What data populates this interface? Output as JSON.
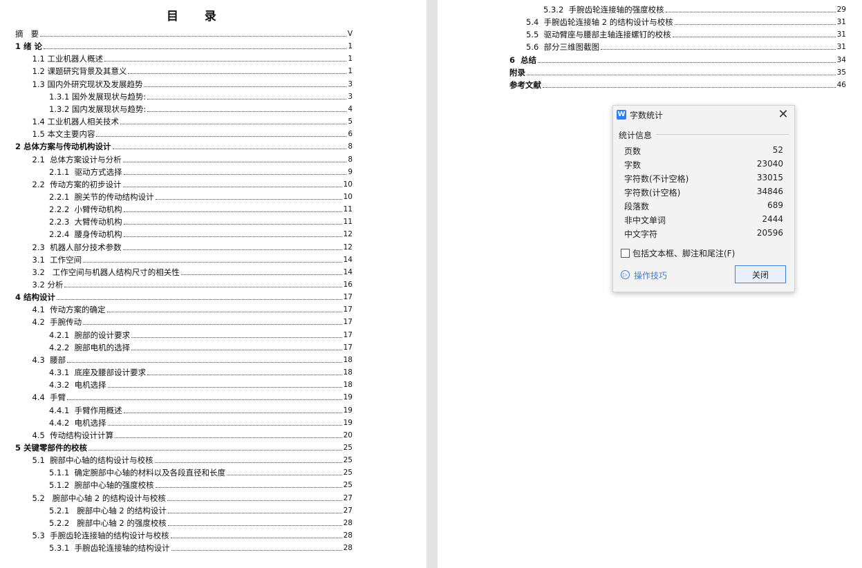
{
  "document": {
    "toc_title": "目  录",
    "left_entries": [
      {
        "label": "摘   要",
        "page": "V",
        "bold": false
      },
      {
        "label": "1 绪 论",
        "page": "1",
        "bold": true
      },
      {
        "label": "1.1 工业机器人概述",
        "page": "1",
        "bold": false
      },
      {
        "label": "1.2 课题研究背景及其意义",
        "page": "1",
        "bold": false
      },
      {
        "label": "1.3 国内外研究现状及发展趋势",
        "page": "3",
        "bold": false
      },
      {
        "label": "1.3.1 国外发展现状与趋势:",
        "page": "3",
        "bold": false
      },
      {
        "label": "1.3.2 国内发展现状与趋势:",
        "page": "4",
        "bold": false
      },
      {
        "label": "1.4 工业机器人相关技术",
        "page": "5",
        "bold": false
      },
      {
        "label": "1.5 本文主要内容",
        "page": "6",
        "bold": false
      },
      {
        "label": "2 总体方案与传动机构设计",
        "page": "8",
        "bold": true
      },
      {
        "label": "2.1  总体方案设计与分析",
        "page": "8",
        "bold": false
      },
      {
        "label": "2.1.1  驱动方式选择",
        "page": "9",
        "bold": false
      },
      {
        "label": "2.2  传动方案的初步设计",
        "page": "10",
        "bold": false
      },
      {
        "label": "2.2.1  腕关节的传动结构设计",
        "page": "10",
        "bold": false
      },
      {
        "label": "2.2.2  小臂传动机构",
        "page": "11",
        "bold": false
      },
      {
        "label": "2.2.3  大臂传动机构",
        "page": "11",
        "bold": false
      },
      {
        "label": "2.2.4  腰身传动机构",
        "page": "12",
        "bold": false
      },
      {
        "label": "2.3  机器人部分技术参数",
        "page": "12",
        "bold": false
      },
      {
        "label": "3.1  工作空间",
        "page": "14",
        "bold": false
      },
      {
        "label": "3.2   工作空间与机器人结构尺寸的相关性",
        "page": "14",
        "bold": false
      },
      {
        "label": "3.2 分析",
        "page": "16",
        "bold": false
      },
      {
        "label": "4 结构设计",
        "page": "17",
        "bold": true
      },
      {
        "label": "4.1  传动方案的确定",
        "page": "17",
        "bold": false
      },
      {
        "label": "4.2  手腕传动",
        "page": "17",
        "bold": false
      },
      {
        "label": "4.2.1  腕部的设计要求",
        "page": "17",
        "bold": false
      },
      {
        "label": "4.2.2  腕部电机的选择",
        "page": "17",
        "bold": false
      },
      {
        "label": "4.3  腰部",
        "page": "18",
        "bold": false
      },
      {
        "label": "4.3.1  底座及腰部设计要求",
        "page": "18",
        "bold": false
      },
      {
        "label": "4.3.2  电机选择",
        "page": "18",
        "bold": false
      },
      {
        "label": "4.4  手臂",
        "page": "19",
        "bold": false
      },
      {
        "label": "4.4.1  手臂作用概述",
        "page": "19",
        "bold": false
      },
      {
        "label": "4.4.2  电机选择",
        "page": "19",
        "bold": false
      },
      {
        "label": "4.5  传动结构设计计算",
        "page": "20",
        "bold": false
      },
      {
        "label": "5 关键零部件的校核",
        "page": "25",
        "bold": true
      },
      {
        "label": "5.1  腕部中心轴的结构设计与校核",
        "page": "25",
        "bold": false
      },
      {
        "label": "5.1.1  确定腕部中心轴的材料以及各段直径和长度",
        "page": "25",
        "bold": false
      },
      {
        "label": "5.1.2  腕部中心轴的强度校核",
        "page": "25",
        "bold": false
      },
      {
        "label": "5.2   腕部中心轴 2 的结构设计与校核",
        "page": "27",
        "bold": false
      },
      {
        "label": "5.2.1   腕部中心轴 2 的结构设计",
        "page": "27",
        "bold": false
      },
      {
        "label": "5.2.2   腕部中心轴 2 的强度校核",
        "page": "28",
        "bold": false
      },
      {
        "label": "5.3  手腕齿轮连接轴的结构设计与校核",
        "page": "28",
        "bold": false
      },
      {
        "label": "5.3.1  手腕齿轮连接轴的结构设计",
        "page": "28",
        "bold": false
      }
    ],
    "right_entries": [
      {
        "label": "5.3.2  手腕齿轮连接轴的强度校核",
        "page": "29",
        "bold": false
      },
      {
        "label": "5.4  手腕齿轮连接轴 2 的结构设计与校核",
        "page": "31",
        "bold": false
      },
      {
        "label": "5.5  驱动臂座与腰部主轴连接螺钉的校核",
        "page": "31",
        "bold": false
      },
      {
        "label": "5.6  部分三维图截图",
        "page": "31",
        "bold": false
      },
      {
        "label": "6  总结",
        "page": "34",
        "bold": true
      },
      {
        "label": "附录",
        "page": "35",
        "bold": true
      },
      {
        "label": "参考文献",
        "page": "46",
        "bold": true
      }
    ]
  },
  "dialog": {
    "app_icon": "W",
    "title": "字数统计",
    "close_glyph": "✕",
    "section_label": "统计信息",
    "stats": [
      {
        "label": "页数",
        "value": "52"
      },
      {
        "label": "字数",
        "value": "23040"
      },
      {
        "label": "字符数(不计空格)",
        "value": "33015"
      },
      {
        "label": "字符数(计空格)",
        "value": "34846"
      },
      {
        "label": "段落数",
        "value": "689"
      },
      {
        "label": "非中文单词",
        "value": "2444"
      },
      {
        "label": "中文字符",
        "value": "20596"
      }
    ],
    "checkbox_label": "包括文本框、脚注和尾注(F)",
    "checkbox_checked": false,
    "tips_label": "操作技巧",
    "tips_icon": "▷",
    "close_button": "关闭"
  },
  "colors": {
    "accent": "#3b7de0",
    "app_icon_bg": "#2d7ff9",
    "dialog_bg": "#f3f3f3",
    "gutter": "#e4e4e4"
  }
}
